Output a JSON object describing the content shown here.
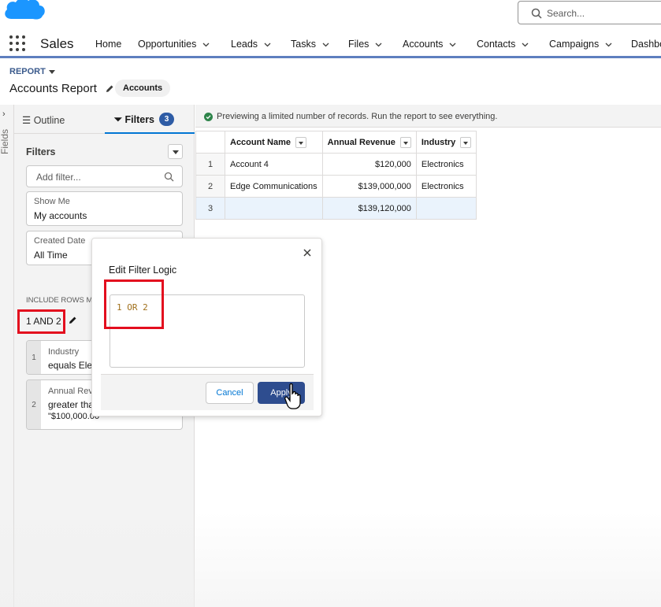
{
  "header": {
    "search_placeholder": "Search..."
  },
  "nav": {
    "app_name": "Sales",
    "items": [
      {
        "label": "Home",
        "has_menu": false
      },
      {
        "label": "Opportunities",
        "has_menu": true
      },
      {
        "label": "Leads",
        "has_menu": true
      },
      {
        "label": "Tasks",
        "has_menu": true
      },
      {
        "label": "Files",
        "has_menu": true
      },
      {
        "label": "Accounts",
        "has_menu": true
      },
      {
        "label": "Contacts",
        "has_menu": true
      },
      {
        "label": "Campaigns",
        "has_menu": true
      },
      {
        "label": "Dashbo",
        "has_menu": false
      }
    ]
  },
  "report": {
    "eyebrow": "REPORT",
    "title": "Accounts Report",
    "type_pill": "Accounts"
  },
  "rail": {
    "label": "Fields"
  },
  "panel": {
    "tab_outline": "Outline",
    "tab_filters": "Filters",
    "filter_count": "3",
    "filters_heading": "Filters",
    "add_filter_placeholder": "Add filter...",
    "show_me": {
      "title": "Show Me",
      "value": "My accounts"
    },
    "created_date": {
      "title": "Created Date",
      "value": "All Time"
    },
    "include_rows_label": "INCLUDE ROWS M",
    "logic_text": "1 AND 2",
    "conditions": [
      {
        "num": "1",
        "field": "Industry",
        "line1": "equals Elec",
        "line2": ""
      },
      {
        "num": "2",
        "field": "Annual Rev",
        "line1": "greater tha",
        "line2": "\"$100,000.00"
      }
    ]
  },
  "main": {
    "preview_banner": "Previewing a limited number of records. Run the report to see everything.",
    "table": {
      "columns": [
        "Account Name",
        "Annual Revenue",
        "Industry"
      ],
      "rows": [
        {
          "num": "1",
          "account": "Account 4",
          "revenue": "$120,000",
          "industry": "Electronics"
        },
        {
          "num": "2",
          "account": "Edge Communications",
          "revenue": "$139,000,000",
          "industry": "Electronics"
        }
      ],
      "total": {
        "num": "3",
        "account": "",
        "revenue": "$139,120,000",
        "industry": ""
      }
    }
  },
  "popover": {
    "title": "Edit Filter Logic",
    "logic_value": "1 OR 2",
    "cancel_label": "Cancel",
    "apply_label": "Apply"
  },
  "colors": {
    "brand_blue": "#0176d3",
    "apply_button": "#2e4d8f",
    "highlight_red": "#e30e1e",
    "nav_underline": "#5e7fbf"
  }
}
